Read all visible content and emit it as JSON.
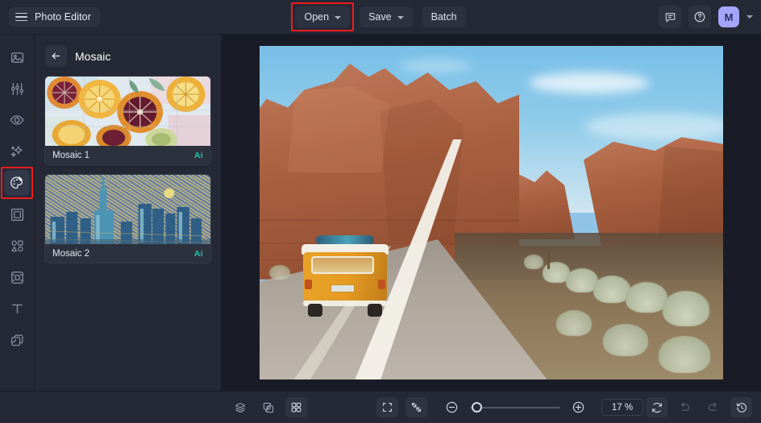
{
  "header": {
    "menu_icon": "hamburger-icon",
    "title": "Photo Editor",
    "tools": [
      {
        "label": "Open",
        "icon": "chevron-down-icon",
        "has_caret": true,
        "highlighted": true
      },
      {
        "label": "Save",
        "icon": "chevron-down-icon",
        "has_caret": true,
        "highlighted": false
      },
      {
        "label": "Batch",
        "icon": "",
        "has_caret": false,
        "highlighted": false
      }
    ],
    "feedback_icon": "chat-bubble-icon",
    "help_icon": "help-circle-icon",
    "avatar_initial": "M",
    "avatar_caret_icon": "chevron-down-icon",
    "avatar_color": "#a5a6fb"
  },
  "sidebar": {
    "items": [
      {
        "icon": "image-icon",
        "name": "image",
        "active": false,
        "highlighted": false
      },
      {
        "icon": "sliders-icon",
        "name": "adjust",
        "active": false,
        "highlighted": false
      },
      {
        "icon": "eye-icon",
        "name": "retouch",
        "active": false,
        "highlighted": false
      },
      {
        "icon": "sparkles-icon",
        "name": "ai-effects",
        "active": false,
        "highlighted": false
      },
      {
        "icon": "palette-icon",
        "name": "effects",
        "active": true,
        "highlighted": true
      },
      {
        "icon": "frame-icon",
        "name": "frames",
        "active": false,
        "highlighted": false
      },
      {
        "icon": "shapes-icon",
        "name": "elements",
        "active": false,
        "highlighted": false
      },
      {
        "icon": "crop-icon",
        "name": "transform",
        "active": false,
        "highlighted": false
      },
      {
        "icon": "text-icon",
        "name": "text",
        "active": false,
        "highlighted": false
      },
      {
        "icon": "layers-copy-icon",
        "name": "layers",
        "active": false,
        "highlighted": false
      }
    ]
  },
  "panel": {
    "back_icon": "arrow-left-icon",
    "title": "Mosaic",
    "presets": [
      {
        "name": "Mosaic 1",
        "badge": "Ai",
        "thumb": "citrus-mosaic"
      },
      {
        "name": "Mosaic 2",
        "badge": "Ai",
        "thumb": "skyline-mosaic"
      }
    ],
    "badge_color": "#1fc5a8"
  },
  "canvas": {
    "image_description": "Yellow vintage van driving on a desert road beside red rock formations"
  },
  "footer": {
    "left_tools": [
      {
        "icon": "layers-stack-icon",
        "name": "layers",
        "active": false
      },
      {
        "icon": "compare-icon",
        "name": "compare",
        "active": false
      },
      {
        "icon": "grid-icon",
        "name": "grid",
        "active": true
      }
    ],
    "view_tools": [
      {
        "icon": "fit-screen-icon",
        "name": "fit-to-screen",
        "active": true
      },
      {
        "icon": "shrink-icon",
        "name": "actual-size",
        "active": true
      }
    ],
    "zoom_out_icon": "minus-circle-icon",
    "zoom_in_icon": "plus-circle-icon",
    "zoom_value": "17 %",
    "zoom_percent": 17,
    "right_tools": [
      {
        "icon": "reset-icon",
        "name": "reset",
        "enabled": true
      },
      {
        "icon": "undo-icon",
        "name": "undo",
        "enabled": false
      },
      {
        "icon": "redo-icon",
        "name": "redo",
        "enabled": false
      },
      {
        "icon": "history-icon",
        "name": "history",
        "enabled": true
      }
    ]
  },
  "theme": {
    "chrome_bg": "#252936",
    "canvas_bg": "#191c26",
    "highlight": "#f01c1c"
  }
}
